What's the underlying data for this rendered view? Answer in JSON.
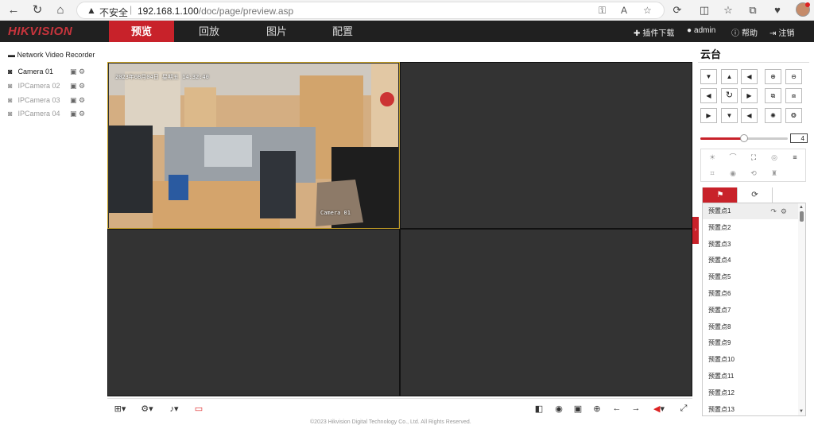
{
  "browser": {
    "insecure_label": "不安全",
    "url_host": "192.168.1.100",
    "url_path": "/doc/page/preview.asp"
  },
  "header": {
    "logo": "HIKVISION",
    "nav": [
      "预览",
      "回放",
      "图片",
      "配置"
    ],
    "plugin_download": "插件下载",
    "user": "admin",
    "help": "帮助",
    "logout": "注销"
  },
  "tree": {
    "root": "Network Video Recorder",
    "cameras": [
      {
        "label": "Camera 01",
        "enabled": true
      },
      {
        "label": "IPCamera 02",
        "enabled": false
      },
      {
        "label": "IPCamera 03",
        "enabled": false
      },
      {
        "label": "IPCamera 04",
        "enabled": false
      }
    ]
  },
  "video": {
    "osd_timestamp": "2023年08月04日 星期五 14:32:40",
    "osd_channel": "Camera 01"
  },
  "ptz": {
    "title": "云台",
    "speed": 4,
    "speed_fraction": 0.5
  },
  "presets": [
    "预置点1",
    "预置点2",
    "预置点3",
    "预置点4",
    "预置点5",
    "预置点6",
    "预置点7",
    "预置点8",
    "预置点9",
    "预置点10",
    "预置点11",
    "预置点12",
    "预置点13"
  ],
  "footer": "©2023 Hikvision Digital Technology Co., Ltd. All Rights Reserved.",
  "colors": {
    "accent": "#c8222a",
    "header_bg": "#202020",
    "selected_border": "#c9a327"
  }
}
